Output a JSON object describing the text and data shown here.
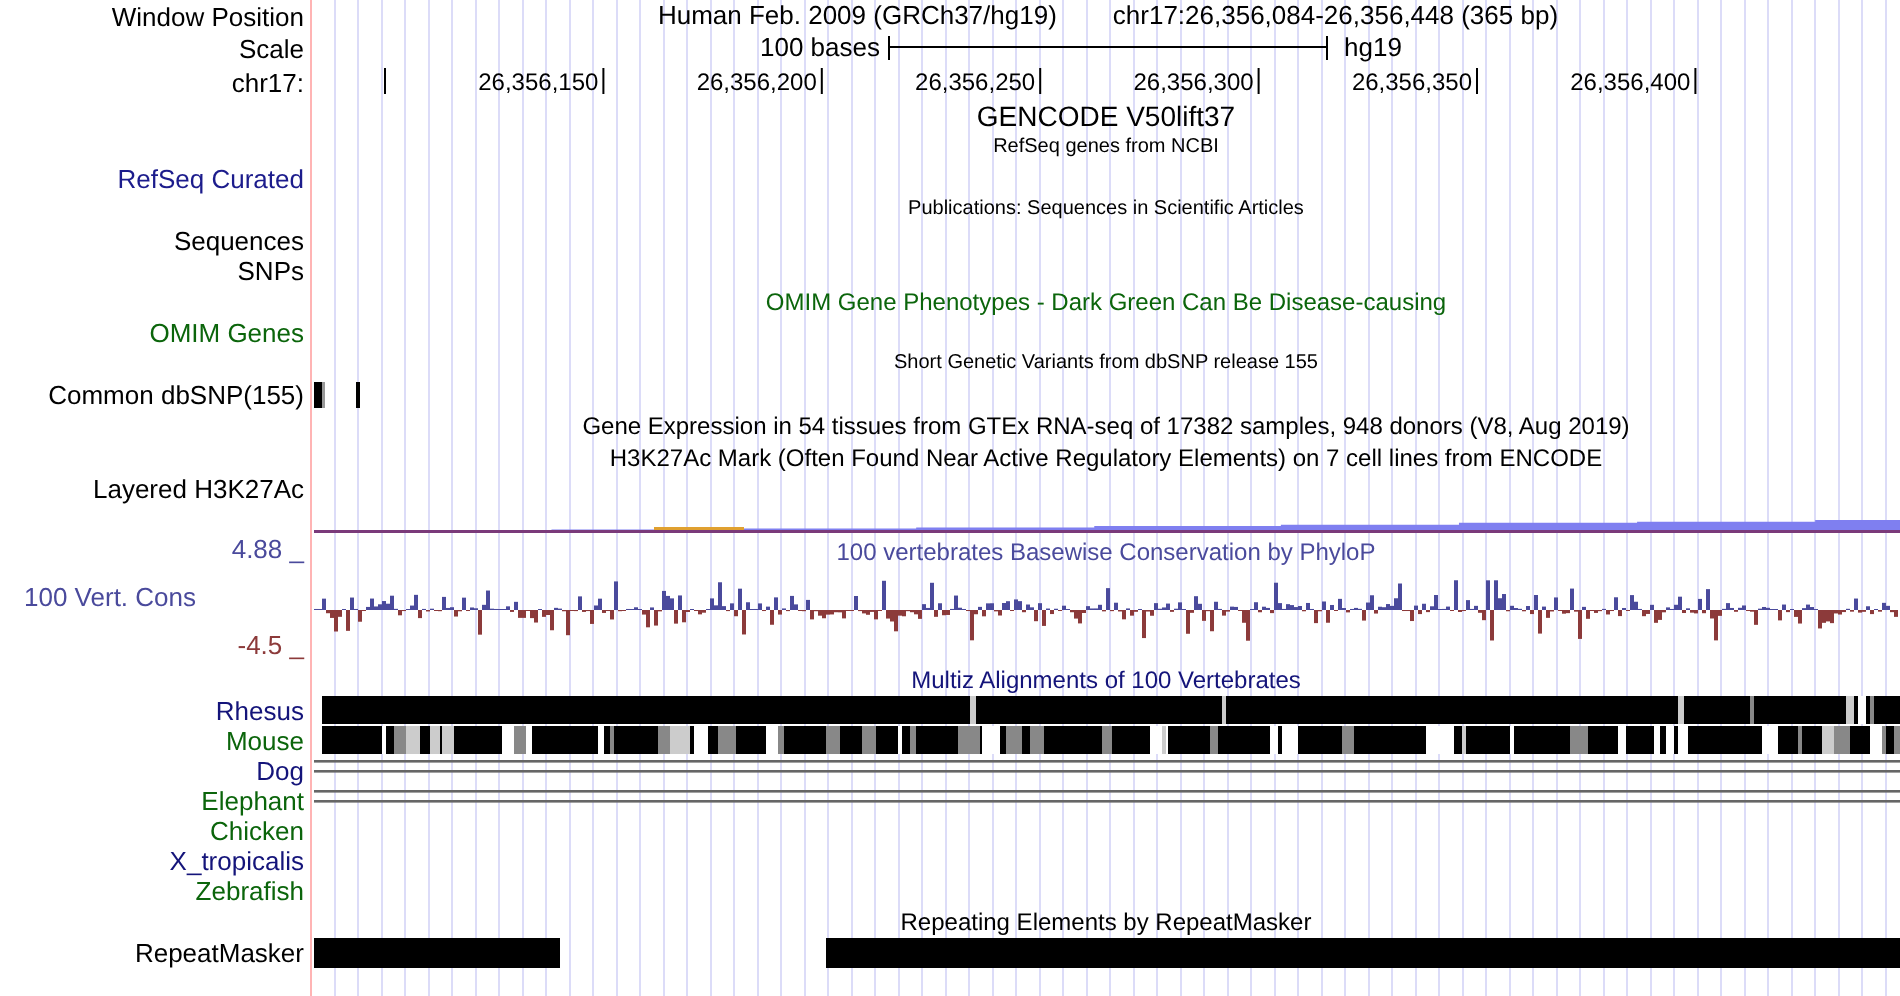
{
  "header": {
    "window_label": "Window Position",
    "assembly": "Human Feb. 2009 (GRCh37/hg19)",
    "position": "chr17:26,356,084-26,356,448 (365 bp)",
    "scale_label": "Scale",
    "scale_text": "100 bases",
    "scale_db": "hg19",
    "chrom_label": "chr17:",
    "ruler_ticks": [
      "26,356,150",
      "26,356,200",
      "26,356,250",
      "26,356,300",
      "26,356,350",
      "26,356,400"
    ]
  },
  "rows": [
    {
      "kind": "group_title",
      "title": "GENCODE V50lift37",
      "color": "#000000"
    },
    {
      "kind": "small_title",
      "title": "RefSeq genes from NCBI",
      "color": "#000000"
    },
    {
      "kind": "empty",
      "label": "RefSeq Curated",
      "color": "#1c1c8c"
    },
    {
      "kind": "small_title",
      "title": "Publications: Sequences in Scientific Articles",
      "color": "#000000"
    },
    {
      "kind": "empty",
      "label": "Sequences",
      "color": "#000000"
    },
    {
      "kind": "empty",
      "label": "SNPs",
      "color": "#000000"
    },
    {
      "kind": "title",
      "title": "OMIM Gene Phenotypes - Dark Green Can Be Disease-causing",
      "color": "#0b650b"
    },
    {
      "kind": "empty",
      "label": "OMIM Genes",
      "color": "#0b650b"
    },
    {
      "kind": "small_title",
      "title": "Short Genetic Variants from dbSNP release 155",
      "color": "#000000"
    },
    {
      "kind": "snp",
      "label": "Common dbSNP(155)",
      "color": "#000000"
    },
    {
      "kind": "title",
      "title": "Gene Expression in 54 tissues from GTEx RNA-seq of 17382 samples, 948 donors (V8, Aug 2019)",
      "color": "#000000"
    },
    {
      "kind": "title",
      "title": "H3K27Ac Mark (Often Found Near Active Regulatory Elements) on 7 cell lines from ENCODE",
      "color": "#000000"
    },
    {
      "kind": "empty",
      "label": "Layered H3K27Ac",
      "color": "#000000"
    },
    {
      "kind": "layered"
    },
    {
      "kind": "wiggle",
      "title": "100 vertebrates Basewise Conservation by PhyloP",
      "label": "100 Vert. Cons",
      "color": "#4a4a9c",
      "axis_labels": [
        {
          "text": "4.88 _",
          "color": "#4a4a9c"
        },
        {
          "text": "-4.5 _",
          "color": "#8c3a3a"
        }
      ]
    },
    {
      "kind": "title",
      "title": "Multiz Alignments of 100 Vertebrates",
      "color": "#14147a"
    },
    {
      "kind": "alignment",
      "label": "Rhesus",
      "color": "#14147a"
    },
    {
      "kind": "alignment",
      "label": "Mouse",
      "color": "#0b650b"
    },
    {
      "kind": "lines",
      "label": "Dog",
      "color": "#14147a"
    },
    {
      "kind": "lines",
      "label": "Elephant",
      "color": "#0b650b"
    },
    {
      "kind": "empty",
      "label": "Chicken",
      "color": "#0b650b"
    },
    {
      "kind": "empty",
      "label": "X_tropicalis",
      "color": "#14147a"
    },
    {
      "kind": "empty",
      "label": "Zebrafish",
      "color": "#0b650b"
    },
    {
      "kind": "title",
      "title": "Repeating Elements by RepeatMasker",
      "color": "#000000"
    },
    {
      "kind": "repeat",
      "label": "RepeatMasker",
      "color": "#000000"
    }
  ]
}
